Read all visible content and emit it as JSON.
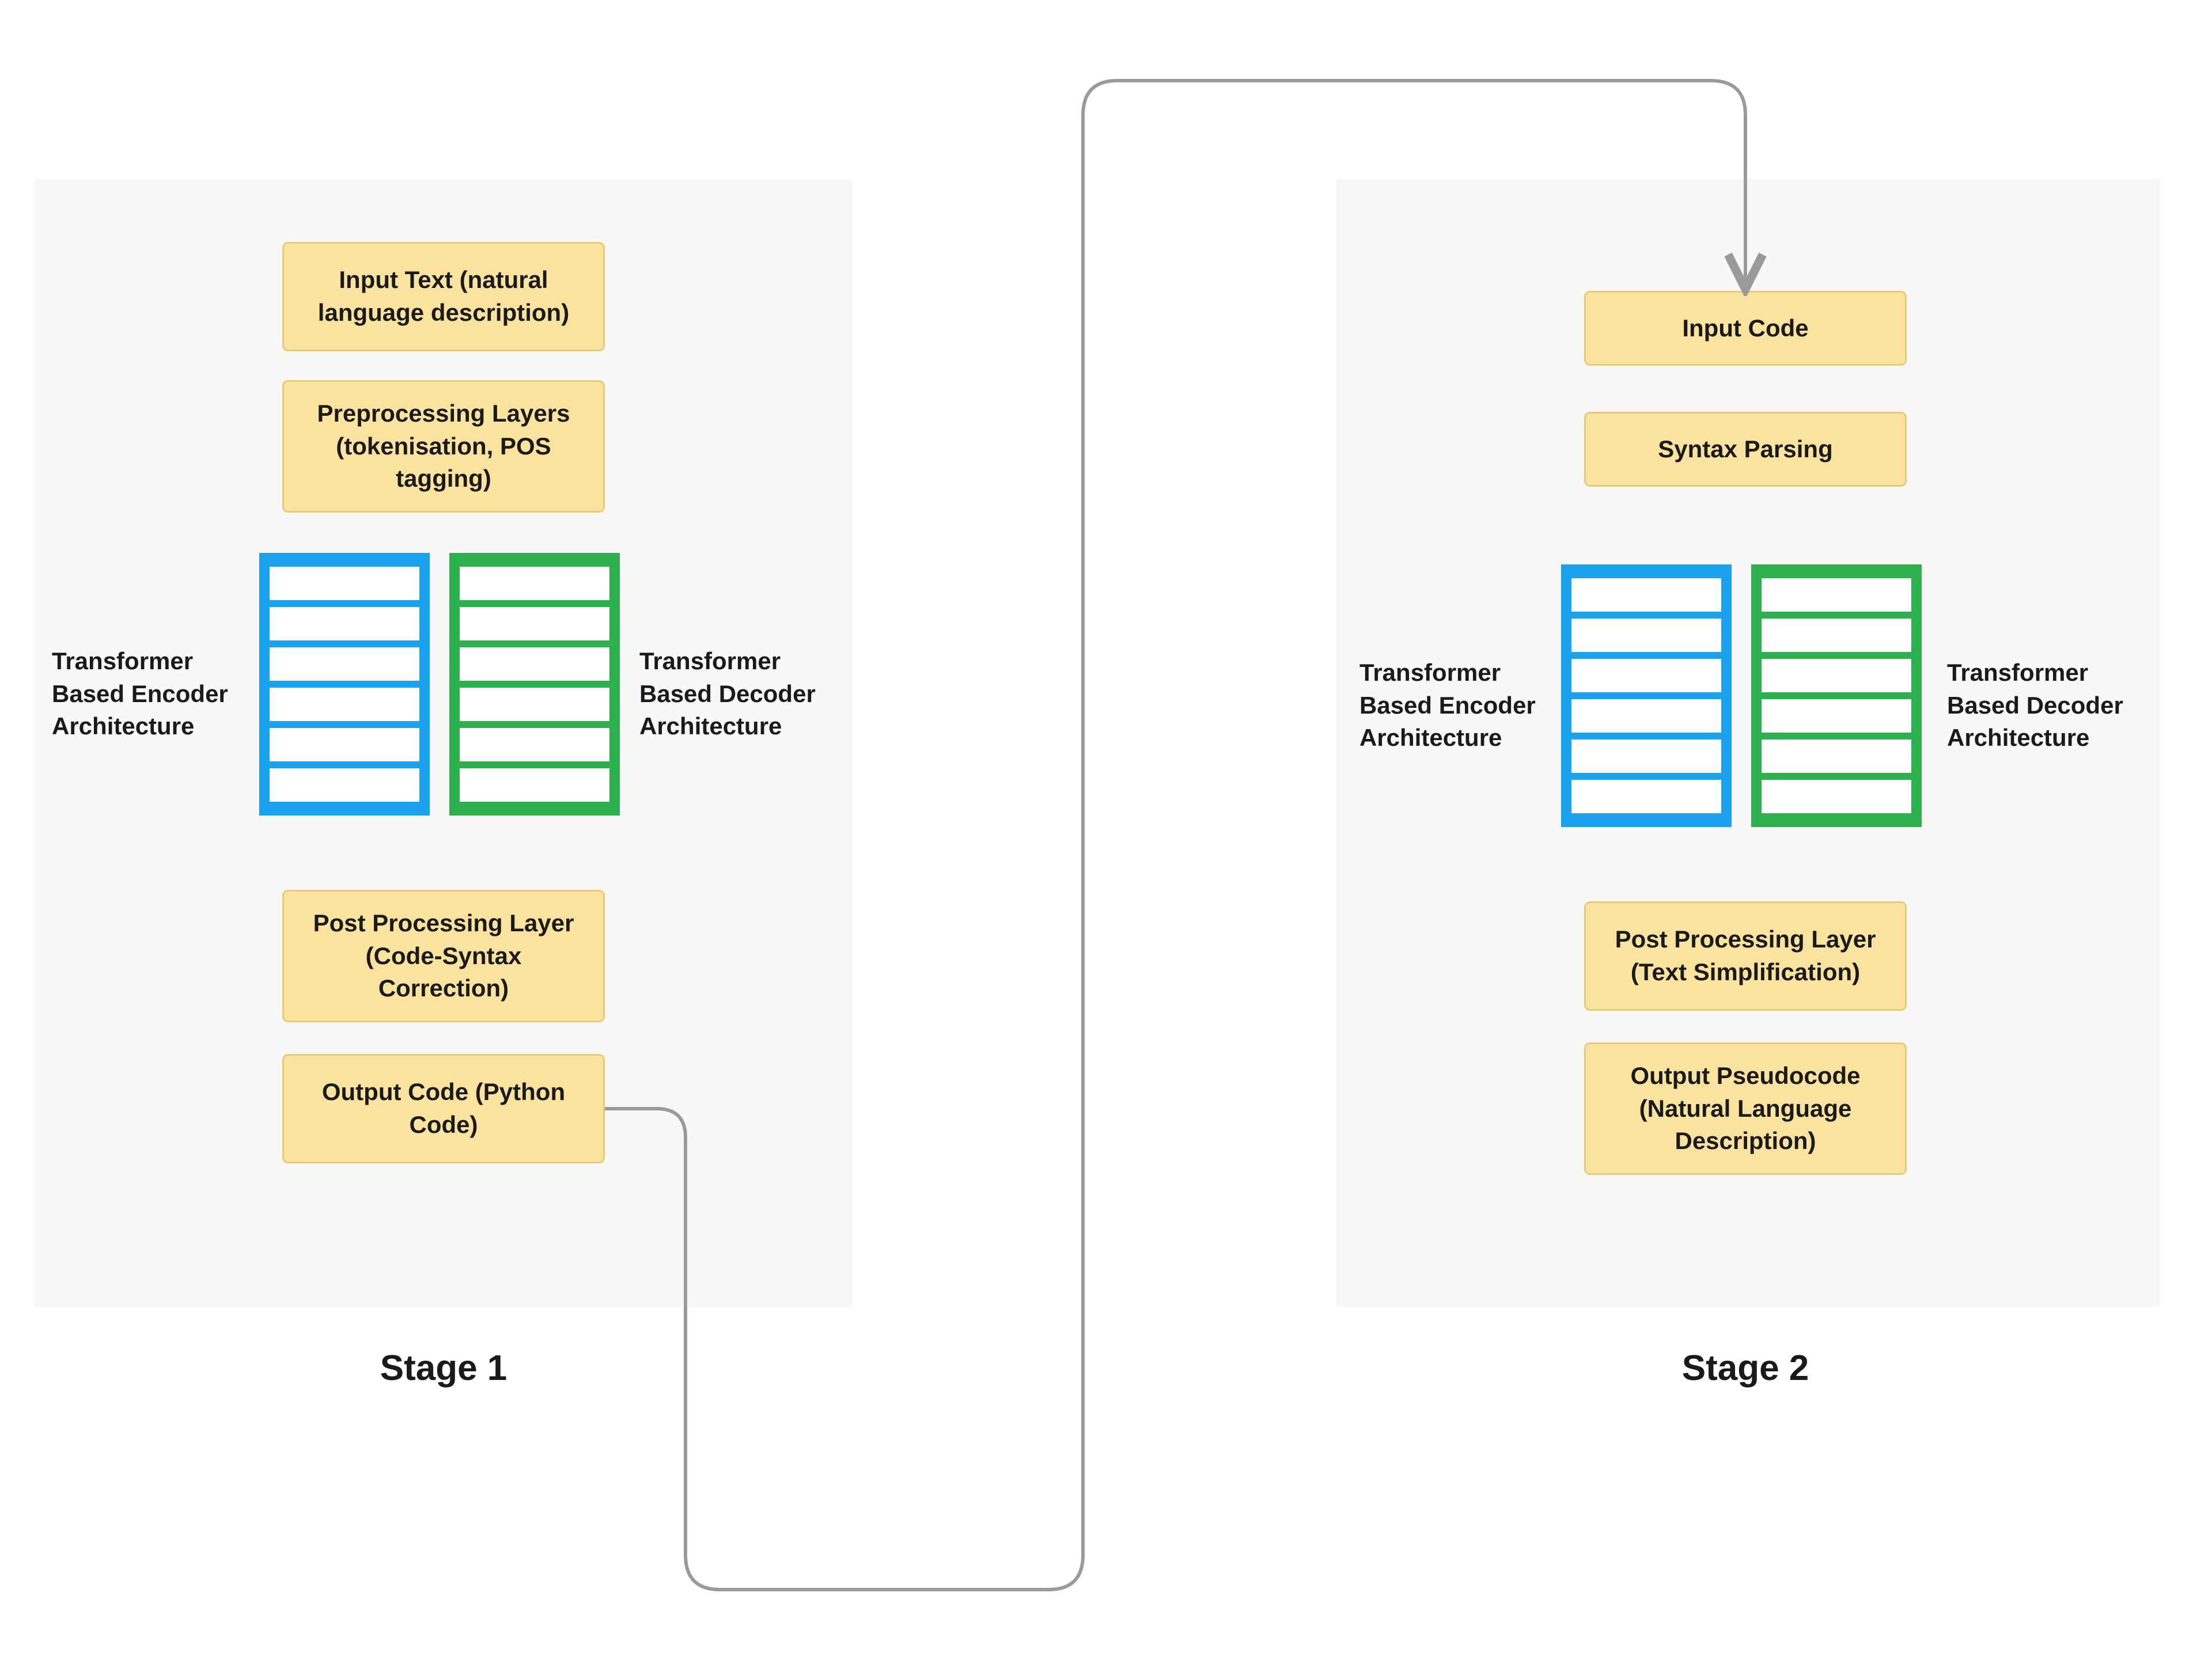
{
  "colors": {
    "box_fill": "#fae29f",
    "box_border": "#e9ca7a",
    "encoder_blue": "#1aa2ee",
    "decoder_green": "#2db14f",
    "stage_bg": "#f8f8f6",
    "connector": "#b9b9b9"
  },
  "stage1": {
    "title": "Stage 1",
    "boxes": {
      "input": "Input Text (natural language description)",
      "preprocess": "Preprocessing Layers (tokenisation, POS tagging)",
      "post": "Post Processing Layer (Code-Syntax Correction)",
      "output": "Output Code (Python Code)"
    },
    "encoder_label": "Transformer Based Encoder Architecture",
    "decoder_label": "Transformer Based Decoder Architecture",
    "stack_rows": 6
  },
  "stage2": {
    "title": "Stage 2",
    "boxes": {
      "input": "Input Code",
      "parse": "Syntax Parsing",
      "post": "Post Processing Layer (Text Simplification)",
      "output": "Output Pseudocode (Natural Language Description)"
    },
    "encoder_label": "Transformer Based Encoder Architecture",
    "decoder_label": "Transformer Based Decoder Architecture",
    "stack_rows": 6
  }
}
